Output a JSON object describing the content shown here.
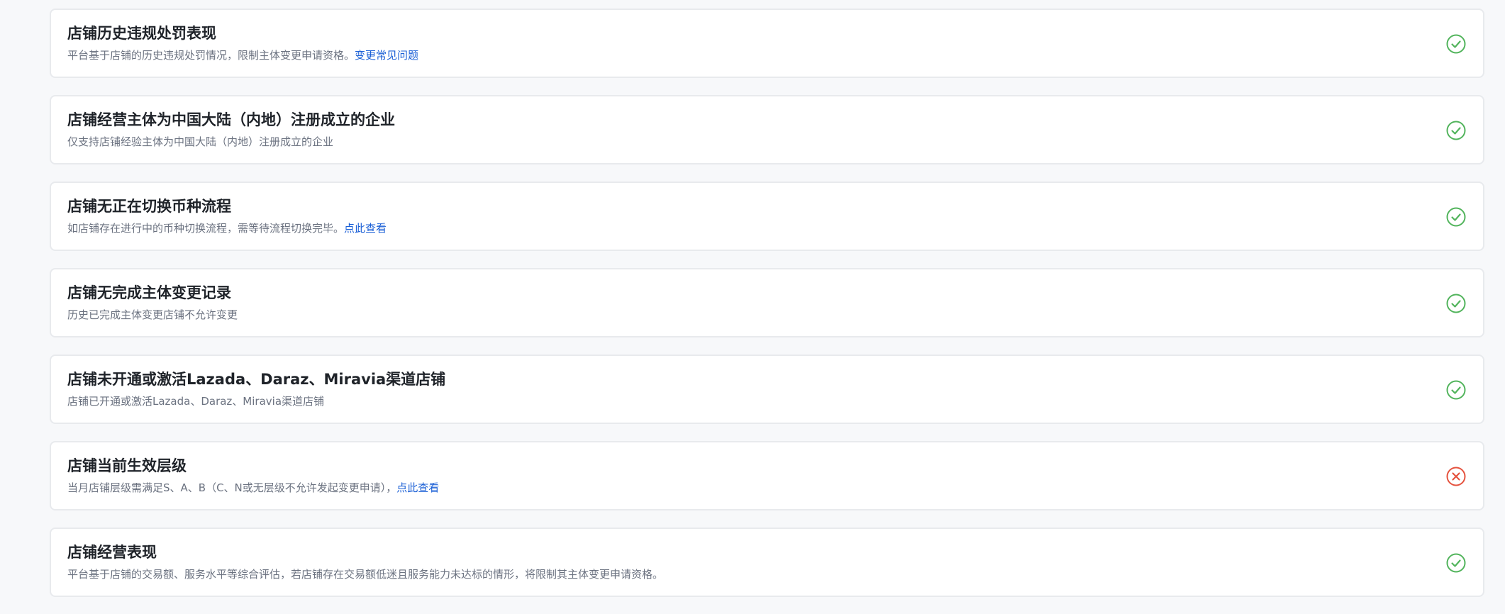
{
  "colors": {
    "pass": "#52b45c",
    "fail": "#e5533f",
    "link": "#1a5fd6"
  },
  "requirements": [
    {
      "title": "店铺历史违规处罚表现",
      "description": "平台基于店铺的历史违规处罚情况，限制主体变更申请资格。",
      "link": "变更常见问题",
      "status": "pass",
      "status_icon": "check-circle-icon"
    },
    {
      "title": "店铺经营主体为中国大陆（内地）注册成立的企业",
      "description": "仅支持店铺经验主体为中国大陆（内地）注册成立的企业",
      "link": "",
      "status": "pass",
      "status_icon": "check-circle-icon"
    },
    {
      "title": "店铺无正在切换币种流程",
      "description": "如店铺存在进行中的币种切换流程，需等待流程切换完毕。",
      "link": "点此查看",
      "status": "pass",
      "status_icon": "check-circle-icon"
    },
    {
      "title": "店铺无完成主体变更记录",
      "description": "历史已完成主体变更店铺不允许变更",
      "link": "",
      "status": "pass",
      "status_icon": "check-circle-icon"
    },
    {
      "title": "店铺未开通或激活Lazada、Daraz、Miravia渠道店铺",
      "description": "店铺已开通或激活Lazada、Daraz、Miravia渠道店铺",
      "link": "",
      "status": "pass",
      "status_icon": "check-circle-icon"
    },
    {
      "title": "店铺当前生效层级",
      "description": "当月店铺层级需满足S、A、B（C、N或无层级不允许发起变更申请），",
      "link": "点此查看",
      "status": "fail",
      "status_icon": "x-circle-icon"
    },
    {
      "title": "店铺经营表现",
      "description": "平台基于店铺的交易额、服务水平等综合评估，若店铺存在交易额低迷且服务能力未达标的情形，将限制其主体变更申请资格。",
      "link": "",
      "status": "pass",
      "status_icon": "check-circle-icon"
    }
  ]
}
